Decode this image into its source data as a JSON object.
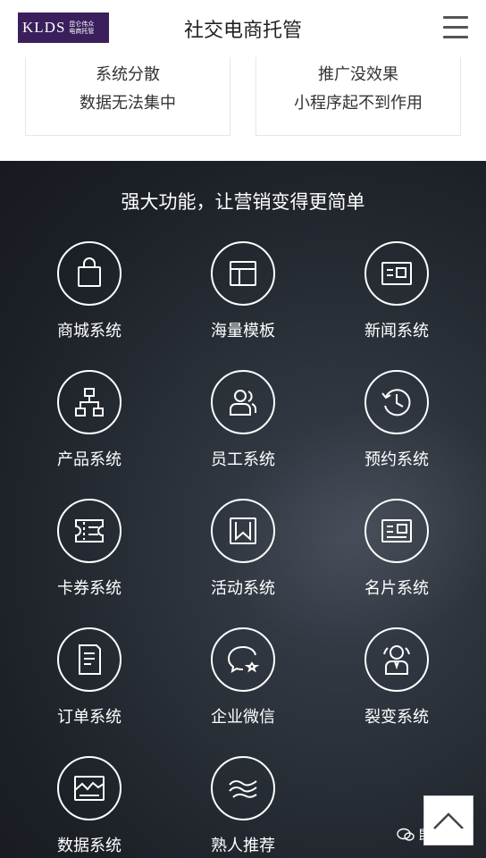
{
  "header": {
    "logo_text": "KLDS",
    "logo_sub_line1": "昆仑伟众",
    "logo_sub_line2": "电商托管",
    "title": "社交电商托管",
    "menu_icon": "hamburger-menu-icon"
  },
  "problems": [
    {
      "line1": "系统分散",
      "line2": "数据无法集中"
    },
    {
      "line1": "推广没效果",
      "line2": "小程序起不到作用"
    }
  ],
  "features": {
    "title": "强大功能，让营销变得更简单",
    "items": [
      {
        "label": "商城系统",
        "icon": "shopping-bag-icon"
      },
      {
        "label": "海量模板",
        "icon": "template-layout-icon"
      },
      {
        "label": "新闻系统",
        "icon": "news-card-icon"
      },
      {
        "label": "产品系统",
        "icon": "hierarchy-icon"
      },
      {
        "label": "员工系统",
        "icon": "staff-users-icon"
      },
      {
        "label": "预约系统",
        "icon": "clock-history-icon"
      },
      {
        "label": "卡券系统",
        "icon": "coupon-ticket-icon"
      },
      {
        "label": "活动系统",
        "icon": "bookmark-frame-icon"
      },
      {
        "label": "名片系统",
        "icon": "business-card-icon"
      },
      {
        "label": "订单系统",
        "icon": "order-document-icon"
      },
      {
        "label": "企业微信",
        "icon": "chat-bubble-icon"
      },
      {
        "label": "裂变系统",
        "icon": "share-user-icon"
      },
      {
        "label": "数据系统",
        "icon": "data-chart-icon"
      },
      {
        "label": "熟人推荐",
        "icon": "handshake-icon"
      }
    ]
  },
  "back_to_top_icon": "chevron-up-icon",
  "watermark": {
    "text": "昆仑伟众",
    "icon": "wechat-icon"
  }
}
